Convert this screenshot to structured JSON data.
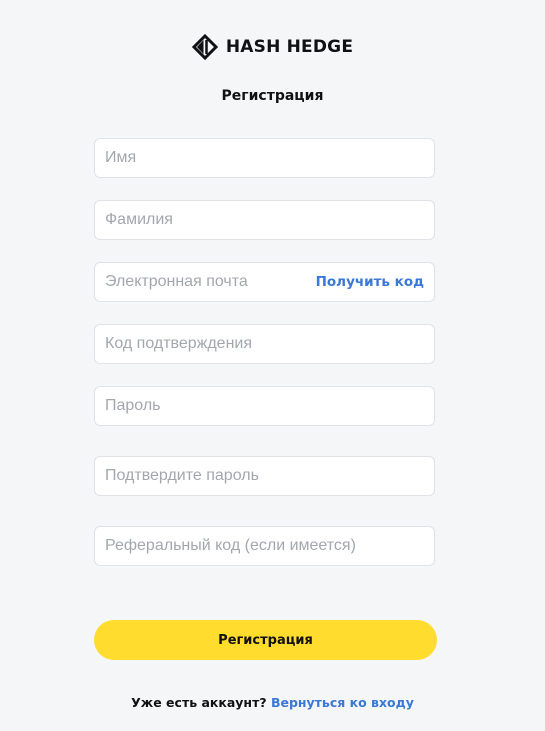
{
  "brand": {
    "name": "HASH HEDGE",
    "logo_icon": "hash-hedge-diamond-icon"
  },
  "page_title": "Регистрация",
  "form": {
    "first_name": {
      "placeholder": "Имя",
      "value": ""
    },
    "last_name": {
      "placeholder": "Фамилия",
      "value": ""
    },
    "email": {
      "placeholder": "Электронная почта",
      "value": "",
      "get_code_label": "Получить код"
    },
    "confirmation_code": {
      "placeholder": "Код подтверждения",
      "value": ""
    },
    "password": {
      "placeholder": "Пароль",
      "value": ""
    },
    "confirm_password": {
      "placeholder": "Подтвердите пароль",
      "value": ""
    },
    "referral_code": {
      "placeholder": "Реферальный код (если имеется)",
      "value": ""
    },
    "submit_label": "Регистрация"
  },
  "footer": {
    "prompt": "Уже есть аккаунт?",
    "login_link": "Вернуться ко входу"
  },
  "colors": {
    "background": "#f5f6f8",
    "accent": "#ffdc2e",
    "link": "#3a78d6"
  }
}
